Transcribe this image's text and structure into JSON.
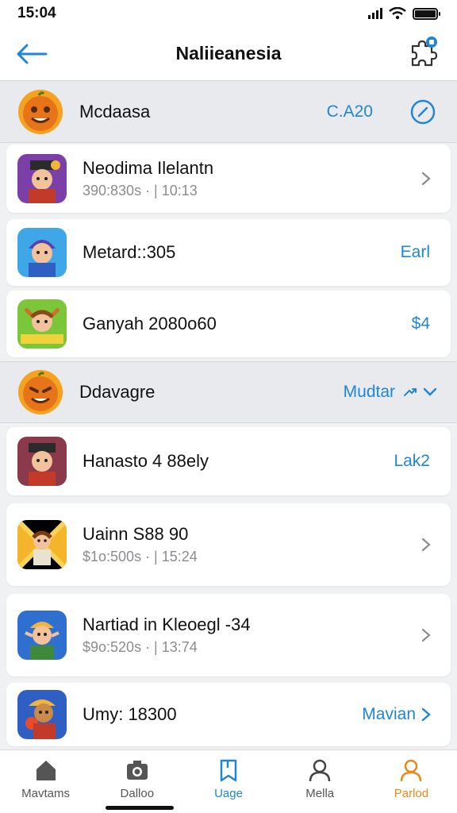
{
  "status_bar": {
    "time": "15:04"
  },
  "nav": {
    "title": "Naliieanesia"
  },
  "colors": {
    "accent": "#1f86d6",
    "active_tab": "#e68a1e"
  },
  "section_1": {
    "title": "Mcdaasa",
    "value": "C.A20",
    "icon": "clock-icon"
  },
  "items_1": [
    {
      "title": "Neodima Ilelantn",
      "subtitle": "390:830s · | 10:13",
      "value": "",
      "chevron": true
    },
    {
      "title": "Metard::305",
      "subtitle": "",
      "value": "Earl",
      "chevron": false
    },
    {
      "title": "Ganyah 2080o60",
      "subtitle": "",
      "value": "$4",
      "chevron": false
    }
  ],
  "section_2": {
    "title": "Ddavagre",
    "value": "Mudtar"
  },
  "items_2": [
    {
      "title": "Hanasto 4 88ely",
      "subtitle": "",
      "value": "Lak2",
      "chevron": false
    },
    {
      "title": "Uainn S88 90",
      "subtitle": "$1o:500s · | 15:24",
      "value": "",
      "chevron": true
    },
    {
      "title": "Nartiad in Kleoegl -34",
      "subtitle": "$9o:520s · | 13:74",
      "value": "",
      "chevron": true
    },
    {
      "title": "Umy: 18300",
      "subtitle": "",
      "value": "Mavian",
      "chevron": true
    }
  ],
  "tabs": [
    {
      "label": "Mavtams",
      "icon": "home-icon",
      "active": false
    },
    {
      "label": "Dalloo",
      "icon": "camera-icon",
      "active": false
    },
    {
      "label": "Uage",
      "icon": "bookmark-icon",
      "active": false
    },
    {
      "label": "Mella",
      "icon": "person-icon",
      "active": false
    },
    {
      "label": "Parlod",
      "icon": "person-icon",
      "active": true
    }
  ]
}
